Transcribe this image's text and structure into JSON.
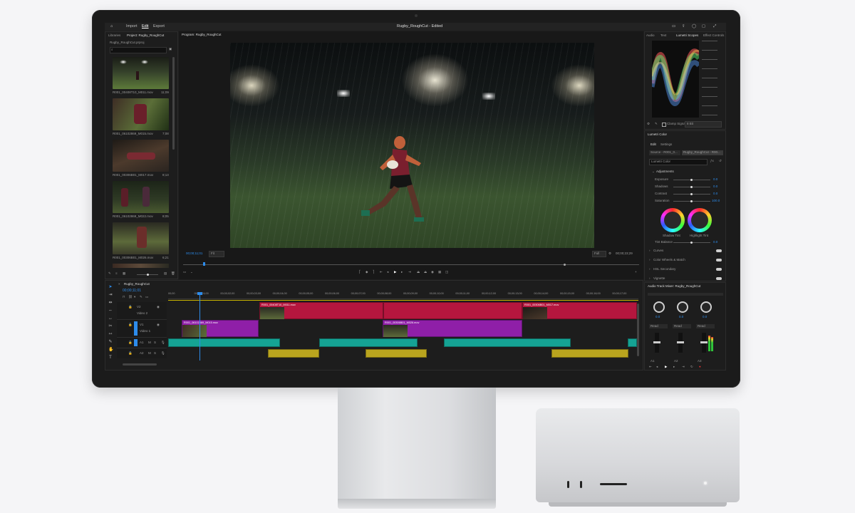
{
  "app": {
    "title": "Rugby_RoughCut - Edited",
    "workspace_tabs": [
      "Import",
      "Edit",
      "Export"
    ],
    "active_workspace": "Edit"
  },
  "project_panel": {
    "tabs": [
      "Libraries",
      "Project: Rugby_RoughCut"
    ],
    "file_name": "Rugby_RoughCut.prproj",
    "thumbnails": [
      {
        "name": "R001_00408T10_M011.mov",
        "duration": "11;09"
      },
      {
        "name": "R001_06102869_M015.mov",
        "duration": "7;08"
      },
      {
        "name": "R001_00306B01_M017.mov",
        "duration": "8;13"
      },
      {
        "name": "R001_06102869_M022.mov",
        "duration": "8;05"
      },
      {
        "name": "R001_00306B01_M026.mov",
        "duration": "6;21"
      }
    ]
  },
  "program_monitor": {
    "tab": "Program: Rugby_RoughCut",
    "timecode_in": "00;00;11;01",
    "fit": "Fit",
    "quality": "Full",
    "timecode_out": "00;00;23;29"
  },
  "timeline": {
    "sequence_tab": "Rugby_RoughCut",
    "timecode": "00;00;11;01",
    "ruler_ticks": [
      "00;00",
      "00;00;01;00",
      "00;00;02;00",
      "00;00;03;00",
      "00;00;04;00",
      "00;00;05;00",
      "00;00;06;00",
      "00;00;07;00",
      "00;00;08;00",
      "00;00;09;00",
      "00;00;10;00",
      "00;00;11;00",
      "00;00;12;00",
      "00;00;13;00",
      "00;00;14;00",
      "00;00;15;00",
      "00;00;16;00",
      "00;00;17;00"
    ],
    "tracks": [
      {
        "id": "V2",
        "name": "Video 2"
      },
      {
        "id": "V1",
        "name": "Video 1"
      },
      {
        "id": "A1",
        "name": ""
      },
      {
        "id": "A2",
        "name": ""
      }
    ],
    "clips_v2": [
      "R001_00408T10_M011.mov",
      "R001_00306B01_M017.mov"
    ],
    "clips_v1": [
      "R001_06102869_M015.mov",
      "R001_00306B01_M026.mov"
    ]
  },
  "right_panel": {
    "tabs": [
      "Lumetri Scopes",
      "Effect Controls",
      "Audio",
      "Text"
    ],
    "scope_clamp_label": "Clamp Signal",
    "scope_bit": "8 Bit",
    "lumetri": {
      "header": "Lumetri Color",
      "tabs": [
        "Edit",
        "Settings"
      ],
      "source": "Source - R001_0...",
      "target": "Rugby_RoughCut - R00...",
      "effect": "Lumetri Color",
      "section": "Adjustments",
      "params": [
        {
          "label": "Exposure",
          "value": "0.0"
        },
        {
          "label": "Shadows",
          "value": "0.0"
        },
        {
          "label": "Contrast",
          "value": "0.0"
        },
        {
          "label": "Saturation",
          "value": "100.0"
        }
      ],
      "wheels": [
        "Shadow Tint",
        "Highlight Tint"
      ],
      "tint_balance": "Tint Balance",
      "tint_value": "0.0",
      "sections": [
        "Curves",
        "Color Wheels & Match",
        "HSL Secondary",
        "Vignette"
      ]
    },
    "audio_mixer": {
      "title": "Audio Track Mixer: Rugby_RoughCut",
      "channels": [
        "A1",
        "A2",
        "A3"
      ],
      "mode": "Read",
      "knob_values": [
        "0.0",
        "0.0",
        "0.0"
      ]
    }
  },
  "colors": {
    "accent_blue": "#2d8ceb",
    "clip_red": "#b5163e",
    "clip_purple": "#8f1fa8",
    "clip_teal": "#15a394",
    "clip_yellow": "#b9a41e",
    "playhead": "#2d8ceb"
  }
}
